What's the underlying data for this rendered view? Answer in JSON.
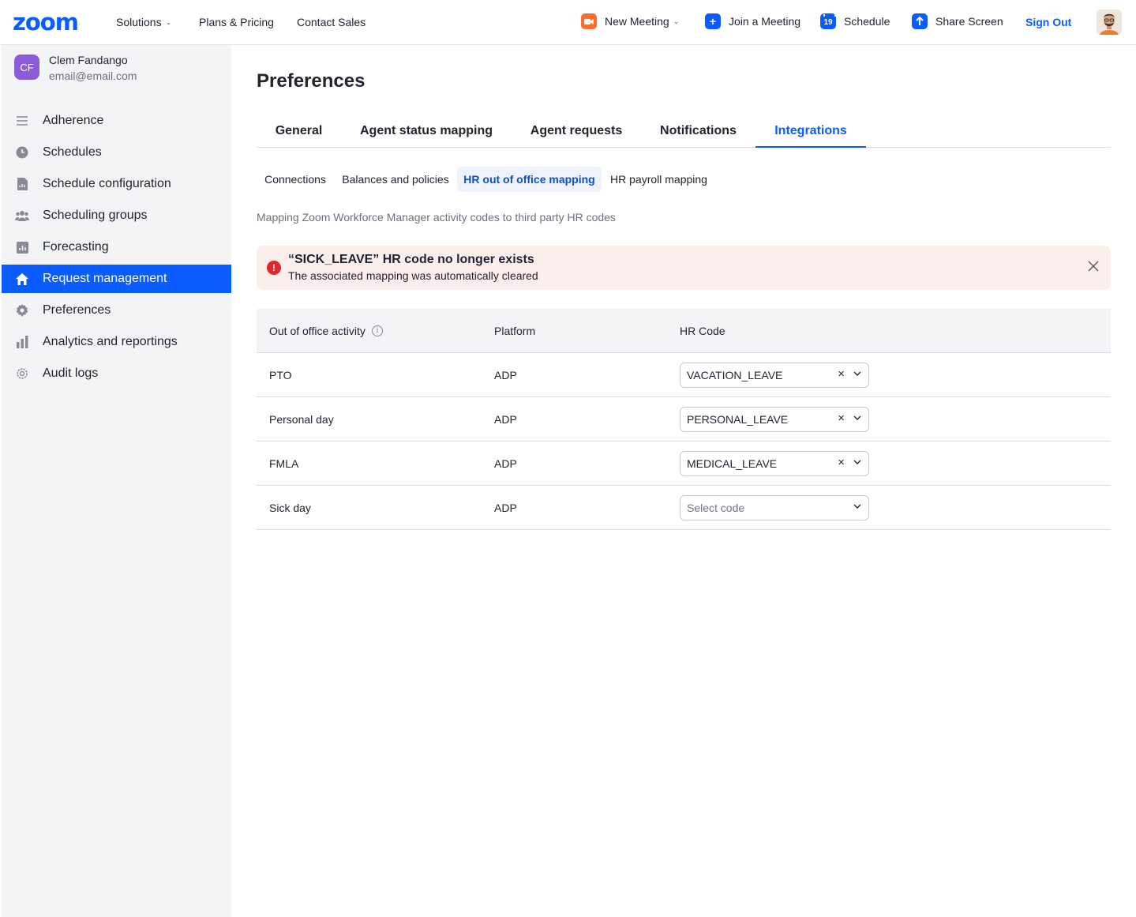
{
  "topnav": {
    "logo": "zoom",
    "solutions": "Solutions",
    "plans": "Plans & Pricing",
    "contact": "Contact Sales",
    "new_meeting": "New Meeting",
    "join_meeting": "Join a Meeting",
    "schedule": "Schedule",
    "schedule_day": "19",
    "share_screen": "Share Screen",
    "sign_out": "Sign Out"
  },
  "sidebar": {
    "user": {
      "initials": "CF",
      "name": "Clem Fandango",
      "email": "email@email.com"
    },
    "items": [
      {
        "label": "Adherence",
        "icon": "list-icon"
      },
      {
        "label": "Schedules",
        "icon": "clock-icon"
      },
      {
        "label": "Schedule configuration",
        "icon": "document-icon"
      },
      {
        "label": "Scheduling groups",
        "icon": "people-icon"
      },
      {
        "label": "Forecasting",
        "icon": "chart-box-icon"
      },
      {
        "label": "Request management",
        "icon": "home-icon",
        "active": true
      },
      {
        "label": "Preferences",
        "icon": "gear-icon"
      },
      {
        "label": "Analytics and reportings",
        "icon": "bar-chart-icon"
      },
      {
        "label": "Audit logs",
        "icon": "gear-outline-icon"
      }
    ]
  },
  "main": {
    "title": "Preferences",
    "tabs": [
      "General",
      "Agent status mapping",
      "Agent requests",
      "Notifications",
      "Integrations"
    ],
    "active_tab": "Integrations",
    "subtabs": [
      "Connections",
      "Balances and policies",
      "HR out of office mapping",
      "HR payroll mapping"
    ],
    "active_subtab": "HR out of office mapping",
    "description": "Mapping Zoom Workforce Manager activity codes to third party HR codes",
    "alert": {
      "title": "“SICK_LEAVE” HR code no longer exists",
      "message": "The associated mapping was automatically cleared"
    },
    "table": {
      "headers": [
        "Out of office activity",
        "Platform",
        "HR Code"
      ],
      "rows": [
        {
          "activity": "PTO",
          "platform": "ADP",
          "code": "VACATION_LEAVE"
        },
        {
          "activity": "Personal day",
          "platform": "ADP",
          "code": "PERSONAL_LEAVE"
        },
        {
          "activity": "FMLA",
          "platform": "ADP",
          "code": "MEDICAL_LEAVE"
        },
        {
          "activity": "Sick day",
          "platform": "ADP",
          "code": ""
        }
      ],
      "select_placeholder": "Select code"
    }
  },
  "colors": {
    "brand": "#0b5cff",
    "alert_bg": "#fdeeee",
    "alert_icon": "#e02828",
    "sidebar_bg": "#f3f4f6"
  }
}
